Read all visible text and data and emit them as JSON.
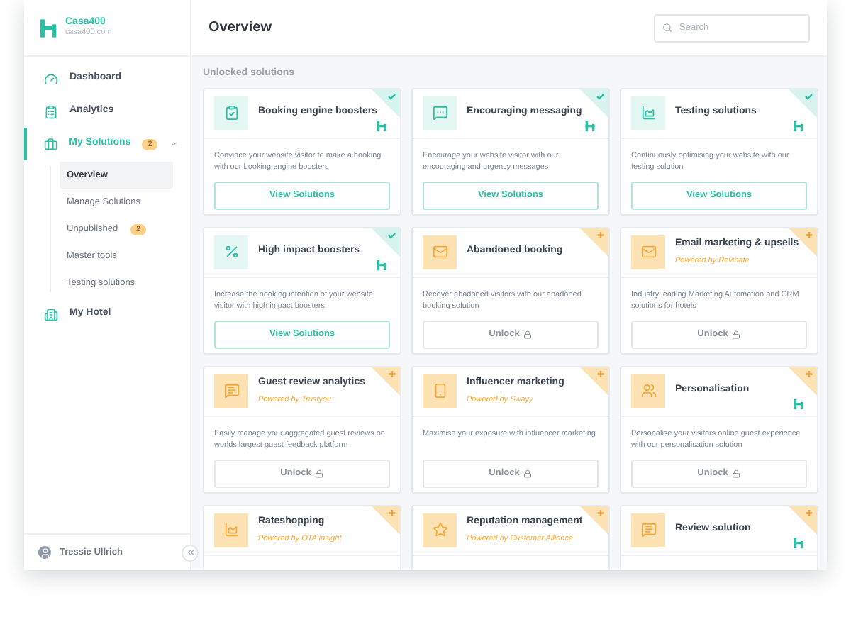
{
  "brand": {
    "name": "Casa400",
    "domain": "casa400.com"
  },
  "header": {
    "title": "Overview",
    "search": {
      "placeholder": "Search"
    }
  },
  "sidebar": {
    "items": [
      {
        "label": "Dashboard",
        "selected": false
      },
      {
        "label": "Analytics",
        "selected": false
      },
      {
        "label": "My Solutions",
        "selected": true,
        "badge": "2",
        "expanded": true,
        "children": [
          {
            "label": "Overview",
            "selected": true
          },
          {
            "label": "Manage Solutions",
            "selected": false
          },
          {
            "label": "Unpublished",
            "selected": false,
            "badge": "2"
          },
          {
            "label": "Master tools",
            "selected": false
          },
          {
            "label": "Testing solutions",
            "selected": false
          }
        ]
      },
      {
        "label": "My Hotel",
        "selected": false
      }
    ],
    "user": {
      "name": "Tressie Ullrich"
    }
  },
  "section_title": "Unlocked solutions",
  "cards": [
    {
      "kind": "unlocked",
      "title": "Booking engine boosters",
      "logo": true,
      "description": "Convince your website visitor to make a booking with our booking engine boosters",
      "button": "View Solutions"
    },
    {
      "kind": "unlocked",
      "title": "Encouraging messaging",
      "logo": true,
      "description": "Encourage your website visitor with our encouraging and urgency messages",
      "button": "View Solutions"
    },
    {
      "kind": "unlocked",
      "title": "Testing solutions",
      "logo": true,
      "description": "Continuously optimising your website with our testing solution",
      "button": "View Solutions"
    },
    {
      "kind": "unlocked",
      "title": "High impact boosters",
      "logo": true,
      "description": "Increase the booking intention of your website visitor with high impact boosters",
      "button": "View Solutions"
    },
    {
      "kind": "locked",
      "title": "Abandoned booking",
      "logo": false,
      "description": "Recover abadoned visitors with our abadoned booking solution",
      "button": "Unlock"
    },
    {
      "kind": "locked",
      "title": "Email marketing & upsells",
      "powered": "Powered by Revinate",
      "logo": false,
      "description": "Industry leading Marketing Automation and CRM solutions for hotels",
      "button": "Unlock"
    },
    {
      "kind": "locked",
      "title": "Guest review analytics",
      "powered": "Powered by Trustyou",
      "logo": false,
      "description": "Easily manage your aggregated guest reviews on worlds largest guest feedback platform",
      "button": "Unlock"
    },
    {
      "kind": "locked",
      "title": "Influencer marketing",
      "powered": "Powered by Swayy",
      "logo": false,
      "description": "Maximise your exposure with influencer marketing",
      "button": "Unlock"
    },
    {
      "kind": "locked",
      "title": "Personalisation",
      "logo": true,
      "description": "Personalise your visitors online guest experience with our personalisation solution",
      "button": "Unlock"
    },
    {
      "kind": "locked",
      "title": "Rateshopping",
      "powered": "Powered by OTA insight",
      "logo": false
    },
    {
      "kind": "locked",
      "title": "Reputation management",
      "powered": "Powered by Customer Alliance",
      "logo": false
    },
    {
      "kind": "locked",
      "title": "Review solution",
      "logo": true
    }
  ]
}
